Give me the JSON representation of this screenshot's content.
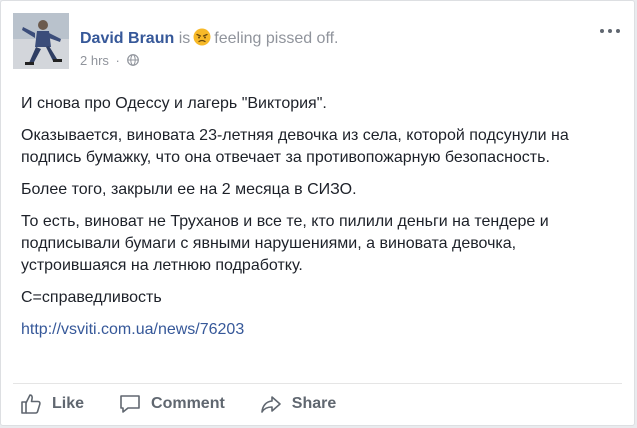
{
  "post": {
    "author": "David Braun",
    "is_text": "is",
    "feeling_text": "feeling pissed off.",
    "timestamp": "2 hrs",
    "separator": "·",
    "paragraphs": [
      "И снова про Одессу и лагерь \"Виктория\".",
      "Оказывается, виновата 23-летняя девочка из села, которой подсунули на подпись бумажку, что она отвечает за противопожарную безопасность.",
      "Более того, закрыли ее на 2 месяца в СИЗО.",
      "То есть, виноват не Труханов и все те, кто пилили деньги на тендере и подписывали бумаги с явными нарушениями, а виновата девочка, устроившаяся на летнюю подработку.",
      "С=справедливость"
    ],
    "link": "http://vsviti.com.ua/news/76203"
  },
  "actions": {
    "like": "Like",
    "comment": "Comment",
    "share": "Share"
  },
  "icons": {
    "feeling": "angry-face-icon",
    "audience": "globe-icon",
    "more": "more-options-icon",
    "like": "thumbs-up-icon",
    "comment": "speech-bubble-icon",
    "share": "share-arrow-icon"
  },
  "colors": {
    "author": "#365899",
    "muted": "#90949c",
    "text": "#1d2129",
    "action": "#606770"
  }
}
